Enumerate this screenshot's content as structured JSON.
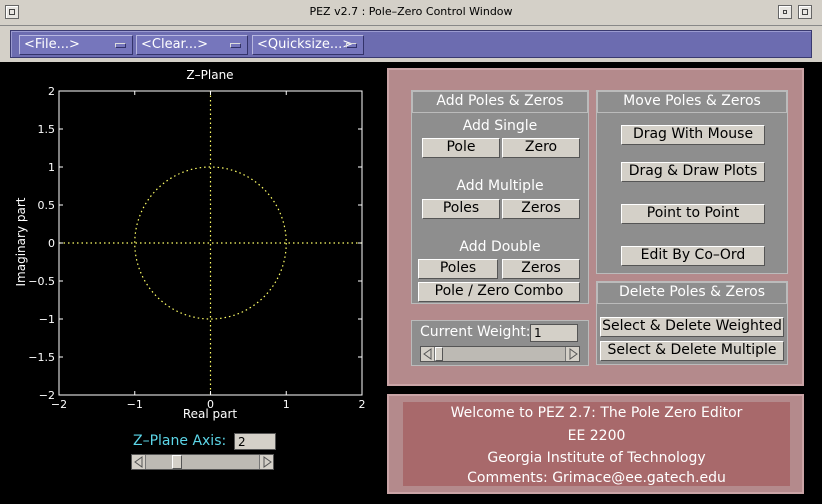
{
  "window": {
    "title": "PEZ v2.7 : Pole–Zero Control Window"
  },
  "menubar": {
    "file": "<File...>",
    "clear": "<Clear...>",
    "quicksize": "<Quicksize...>"
  },
  "plot": {
    "title": "Z–Plane",
    "xlabel": "Real part",
    "ylabel": "Imaginary part",
    "xticks": [
      "−2",
      "−1",
      "0",
      "1",
      "2"
    ],
    "yticks": [
      "2",
      "1.5",
      "1",
      "0.5",
      "0",
      "−0.5",
      "−1",
      "−1.5",
      "−2"
    ],
    "xlim": [
      -2,
      2
    ],
    "ylim": [
      -2,
      2
    ],
    "unit_circle_color": "#ffff66",
    "axis_line_color": "#ffff66"
  },
  "zaxis": {
    "label": "Z–Plane Axis:",
    "value": "2",
    "slider_fraction": 0.25
  },
  "add_group": {
    "title": "Add Poles & Zeros",
    "single_head": "Add Single",
    "single_pole": "Pole",
    "single_zero": "Zero",
    "multiple_head": "Add Multiple",
    "multiple_poles": "Poles",
    "multiple_zeros": "Zeros",
    "double_head": "Add Double",
    "double_poles": "Poles",
    "double_zeros": "Zeros",
    "combo": "Pole / Zero Combo"
  },
  "move_group": {
    "title": "Move Poles & Zeros",
    "drag_mouse": "Drag With Mouse",
    "drag_draw": "Drag & Draw Plots",
    "point_to_point": "Point to Point",
    "edit_coord": "Edit By Co–Ord"
  },
  "delete_group": {
    "title": "Delete Poles & Zeros",
    "weighted": "Select & Delete Weighted",
    "multiple": "Select & Delete Multiple"
  },
  "weight": {
    "label": "Current Weight:",
    "value": "1",
    "slider_fraction": 0.0
  },
  "welcome": {
    "line1": "Welcome to PEZ 2.7: The Pole Zero Editor",
    "line2": "EE 2200",
    "line3": "Georgia Institute of Technology",
    "line4": "Comments: Grimace@ee.gatech.edu"
  },
  "colors": {
    "menubar": "#6c6cb0",
    "panel": "#b48a8c",
    "group": "#8e8e8e",
    "welcome": "#a8696b",
    "zaxis_label": "#5cd6e8"
  }
}
